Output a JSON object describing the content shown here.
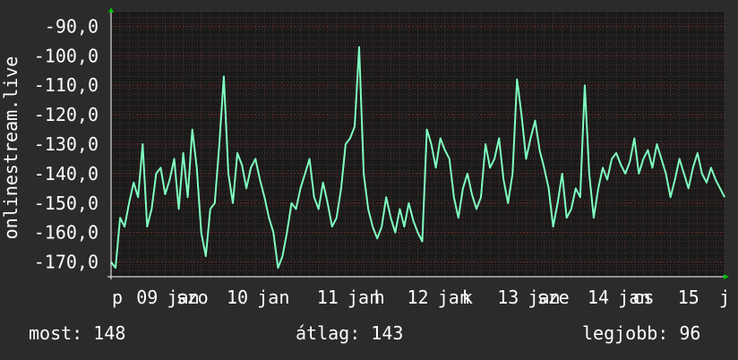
{
  "chart_data": {
    "type": "line",
    "ylabel": "onlinestream.live",
    "ylim": [
      -175,
      -85
    ],
    "yticks": [
      -170,
      -160,
      -150,
      -140,
      -130,
      -120,
      -110,
      -100,
      -90
    ],
    "ytick_labels": [
      "-170,0",
      "-160,0",
      "-150,0",
      "-140,0",
      "-130,0",
      "-120,0",
      "-110,0",
      "-100,0",
      "-90,0"
    ],
    "x_ticks": [
      {
        "label": "p",
        "x": 0.14
      },
      {
        "label": "09",
        "x": 0.8
      },
      {
        "label": "jan",
        "x": 1.6
      },
      {
        "label": "szo",
        "x": 1.8
      },
      {
        "label": "10",
        "x": 2.8
      },
      {
        "label": "jan",
        "x": 3.6
      },
      {
        "label": "11",
        "x": 4.8
      },
      {
        "label": "jan",
        "x": 5.6
      },
      {
        "label": "h",
        "x": 5.95
      },
      {
        "label": "12",
        "x": 6.8
      },
      {
        "label": "jan",
        "x": 7.6
      },
      {
        "label": "k",
        "x": 7.9
      },
      {
        "label": "13",
        "x": 8.8
      },
      {
        "label": "jan",
        "x": 9.6
      },
      {
        "label": "sze",
        "x": 9.8
      },
      {
        "label": "14",
        "x": 10.8
      },
      {
        "label": "jan",
        "x": 11.6
      },
      {
        "label": "cs",
        "x": 11.8
      },
      {
        "label": "15",
        "x": 12.8
      },
      {
        "label": "j",
        "x": 13.6
      }
    ],
    "xlim": [
      0,
      13.6
    ],
    "grid": true,
    "series": [
      {
        "color": "#7fffc0",
        "x": [
          0.0,
          0.1,
          0.2,
          0.3,
          0.4,
          0.5,
          0.6,
          0.7,
          0.8,
          0.9,
          1.0,
          1.1,
          1.2,
          1.3,
          1.4,
          1.5,
          1.6,
          1.7,
          1.8,
          1.9,
          2.0,
          2.1,
          2.2,
          2.3,
          2.4,
          2.5,
          2.6,
          2.7,
          2.8,
          2.9,
          3.0,
          3.1,
          3.2,
          3.3,
          3.4,
          3.5,
          3.6,
          3.7,
          3.8,
          3.9,
          4.0,
          4.1,
          4.2,
          4.3,
          4.4,
          4.5,
          4.6,
          4.7,
          4.8,
          4.9,
          5.0,
          5.1,
          5.2,
          5.3,
          5.4,
          5.5,
          5.6,
          5.7,
          5.8,
          5.9,
          6.0,
          6.1,
          6.2,
          6.3,
          6.4,
          6.5,
          6.6,
          6.7,
          6.8,
          6.9,
          7.0,
          7.1,
          7.2,
          7.3,
          7.4,
          7.5,
          7.6,
          7.7,
          7.8,
          7.9,
          8.0,
          8.1,
          8.2,
          8.3,
          8.4,
          8.5,
          8.6,
          8.7,
          8.8,
          8.9,
          9.0,
          9.1,
          9.2,
          9.3,
          9.4,
          9.5,
          9.6,
          9.7,
          9.8,
          9.9,
          10.0,
          10.1,
          10.2,
          10.3,
          10.4,
          10.5,
          10.6,
          10.7,
          10.8,
          10.9,
          11.0,
          11.1,
          11.2,
          11.3,
          11.4,
          11.5,
          11.6,
          11.7,
          11.8,
          11.9,
          12.0,
          12.1,
          12.2,
          12.3,
          12.4,
          12.5,
          12.6,
          12.7,
          12.8,
          12.9,
          13.0,
          13.1,
          13.2,
          13.3,
          13.4,
          13.5,
          13.6
        ],
        "values": [
          -170,
          -172,
          -155,
          -158,
          -150,
          -143,
          -148,
          -130,
          -158,
          -152,
          -140,
          -138,
          -147,
          -142,
          -135,
          -152,
          -133,
          -148,
          -125,
          -138,
          -160,
          -168,
          -152,
          -150,
          -130,
          -107,
          -140,
          -150,
          -133,
          -137,
          -145,
          -138,
          -135,
          -142,
          -148,
          -155,
          -160,
          -172,
          -168,
          -160,
          -150,
          -152,
          -145,
          -140,
          -135,
          -148,
          -152,
          -143,
          -150,
          -158,
          -155,
          -145,
          -130,
          -128,
          -124,
          -97,
          -140,
          -152,
          -158,
          -162,
          -158,
          -148,
          -155,
          -160,
          -152,
          -158,
          -150,
          -156,
          -160,
          -163,
          -125,
          -130,
          -138,
          -128,
          -132,
          -135,
          -148,
          -155,
          -145,
          -140,
          -147,
          -152,
          -148,
          -130,
          -138,
          -135,
          -128,
          -142,
          -150,
          -140,
          -108,
          -120,
          -135,
          -128,
          -122,
          -132,
          -138,
          -145,
          -158,
          -150,
          -140,
          -155,
          -152,
          -145,
          -148,
          -110,
          -140,
          -155,
          -145,
          -138,
          -142,
          -135,
          -133,
          -137,
          -140,
          -136,
          -128,
          -140,
          -135,
          -132,
          -138,
          -130,
          -135,
          -140,
          -148,
          -142,
          -135,
          -140,
          -145,
          -138,
          -133,
          -140,
          -143,
          -138,
          -142,
          -145,
          -148
        ]
      }
    ]
  },
  "footer": {
    "current": "most: 148",
    "average": "átlag: 143",
    "best": "legjobb: 96"
  }
}
